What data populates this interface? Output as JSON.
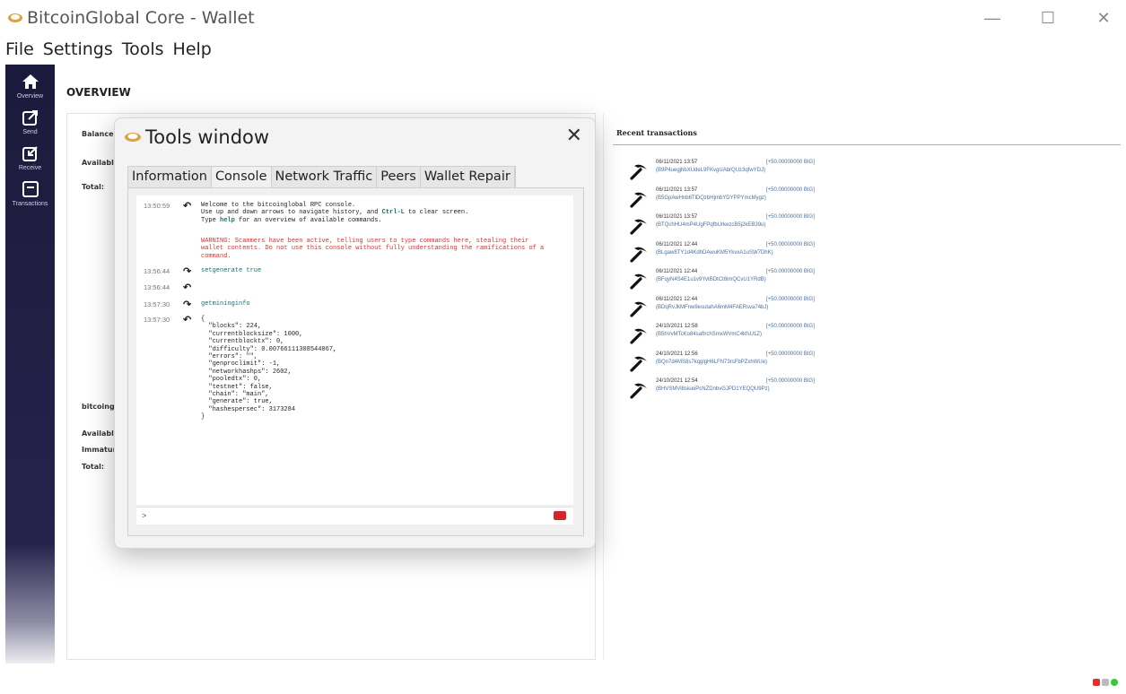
{
  "window": {
    "title": "BitcoinGlobal Core - Wallet",
    "minimize": "—",
    "maximize": "☐",
    "close": "✕"
  },
  "menu": [
    "File",
    "Settings",
    "Tools",
    "Help"
  ],
  "nav": [
    {
      "label": "Overview",
      "icon": "home-icon"
    },
    {
      "label": "Send",
      "icon": "send-icon"
    },
    {
      "label": "Receive",
      "icon": "receive-icon"
    },
    {
      "label": "Transactions",
      "icon": "transactions-icon"
    }
  ],
  "overview": {
    "title": "OVERVIEW",
    "balances_label": "Balance",
    "available_label": "Available:",
    "total_label": "Total:",
    "section2_label": "bitcoing",
    "available2_label": "Available:",
    "immature_label": "Immatur",
    "total2_label": "Total:"
  },
  "recent": {
    "header": "Recent transactions",
    "items": [
      {
        "date": "06/11/2021 13:57",
        "amount": "[+50.00000000 BIG]",
        "address": "(B9P4uegjhbXUdeL9FKvgUAbrQUz3qfwYDJ)"
      },
      {
        "date": "06/11/2021 13:57",
        "amount": "[+50.00000000 BIG]",
        "address": "(B5GpAwHnb6TlDQzbHjmbYDYPPYmcMygz)"
      },
      {
        "date": "06/11/2021 13:57",
        "amount": "[+50.00000000 BIG]",
        "address": "(BTQchHU4mP4UgFPqfbUrkezcB5j2kEB39u)"
      },
      {
        "date": "06/11/2021 12:44",
        "amount": "[+50.00000000 BIG]",
        "address": "(BLgaw8TY1d4KdhDAwuKM5YkvxA1uSW7DhK)"
      },
      {
        "date": "06/11/2021 12:44",
        "amount": "[+50.00000000 BIG]",
        "address": "(BFqyN4S4E1u1v9YvtBDtCt8imQCvU1YRdB)"
      },
      {
        "date": "06/11/2021 12:44",
        "amount": "[+50.00000000 BIG]",
        "address": "(BDqRvJkMFnw9esutahA6mM4FAERsva74bJ)"
      },
      {
        "date": "24/10/2021 12:58",
        "amount": "[+50.00000000 BIG]",
        "address": "(B5hVvMTcKo84saftrchSmxWVmC4kfsU1Z)"
      },
      {
        "date": "24/10/2021 12:56",
        "amount": "[+50.00000000 BIG]",
        "address": "(BQn7d4MS8s7kqglgH6LFN73rsFbPZxhWUe)"
      },
      {
        "date": "24/10/2021 12:54",
        "amount": "[+50.00000000 BIG]",
        "address": "(BHVSMVi8siueiPcNZDnbvGJPD1YEQQU9Pz)"
      }
    ]
  },
  "tools": {
    "title": "Tools window",
    "close": "✕",
    "tabs": [
      "Information",
      "Console",
      "Network Traffic",
      "Peers",
      "Wallet Repair"
    ],
    "active_tab": "Console",
    "console": {
      "lines": [
        {
          "time": "13:50:59",
          "dir": "out",
          "text": ""
        },
        {
          "time": "13:56:44",
          "dir": "in",
          "text": "setgenerate true"
        },
        {
          "time": "13:56:44",
          "dir": "out",
          "text": ""
        },
        {
          "time": "13:57:30",
          "dir": "in",
          "text": "getmininginfo"
        },
        {
          "time": "13:57:30",
          "dir": "out",
          "text": "{\n  \"blocks\": 224,\n  \"currentblocksize\": 1000,\n  \"currentblocktx\": 0,\n  \"difficulty\": 0.00766111308544067,\n  \"errors\": \"\",\n  \"genproclimit\": -1,\n  \"networkhashps\": 2602,\n  \"pooledtx\": 0,\n  \"testnet\": false,\n  \"chain\": \"main\",\n  \"generate\": true,\n  \"hashespersec\": 3173284\n}"
        }
      ],
      "welcome_1": "Welcome to the bitcoinglobal RPC console.",
      "welcome_2a": "Use up and down arrows to navigate history, and ",
      "welcome_2b": "Ctrl-L",
      "welcome_2c": " to clear screen.",
      "welcome_3a": "Type ",
      "welcome_3b": "help",
      "welcome_3c": " for an overview of available commands.",
      "warning": "WARNING: Scammers have been active, telling users to type commands here, stealing their\nwallet contents. Do not use this console without fully understanding the ramifications of a\ncommand.",
      "prompt": ">"
    }
  },
  "colors": {
    "nav_bg": "#1c1a3c",
    "warning": "#e0302c",
    "command": "#1a6f6f",
    "address": "#4a6fa0"
  }
}
